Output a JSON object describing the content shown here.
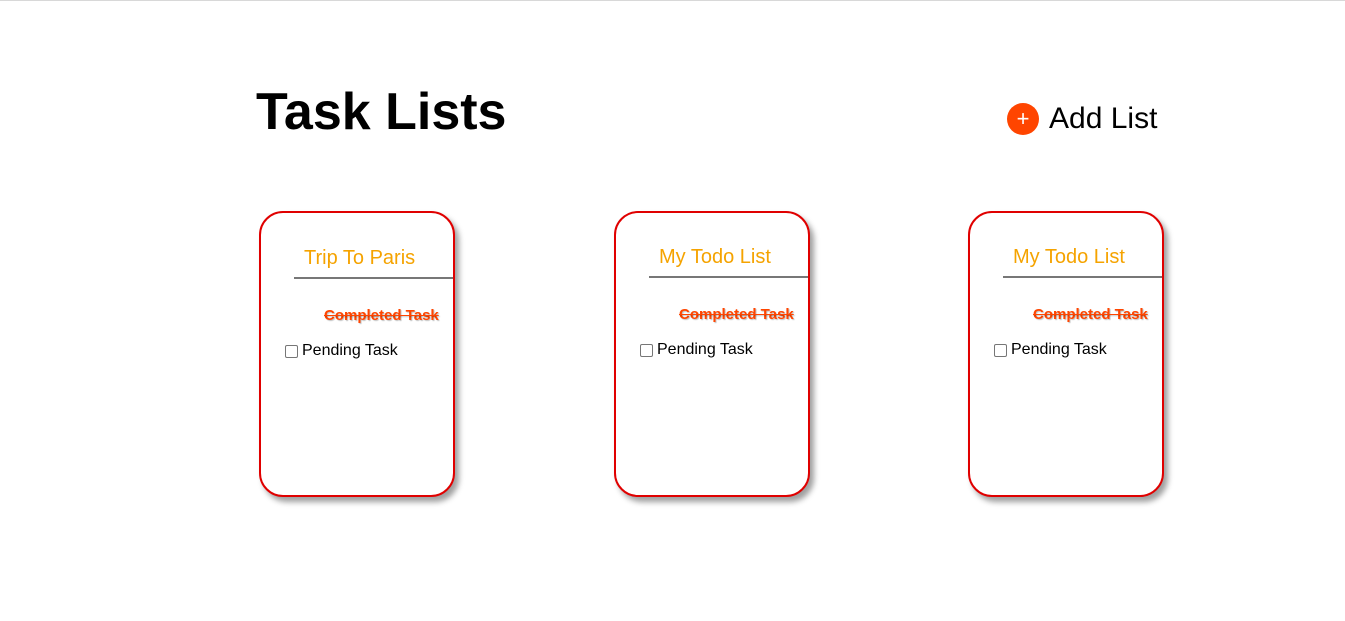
{
  "header": {
    "title": "Task Lists",
    "add_button_icon": "+",
    "add_button_label": "Add List",
    "accent_color": "#ff4500"
  },
  "lists": [
    {
      "title": "Trip To Paris",
      "completed_task": "Completed Task",
      "pending_task": "Pending Task",
      "pending_checked": false
    },
    {
      "title": "My Todo List",
      "completed_task": "Completed Task",
      "pending_task": "Pending Task",
      "pending_checked": false
    },
    {
      "title": "My Todo List",
      "completed_task": "Completed Task",
      "pending_task": "Pending Task",
      "pending_checked": false
    }
  ],
  "colors": {
    "card_border": "#e00000",
    "list_title": "#f5a300",
    "completed_task": "#ff4500"
  }
}
